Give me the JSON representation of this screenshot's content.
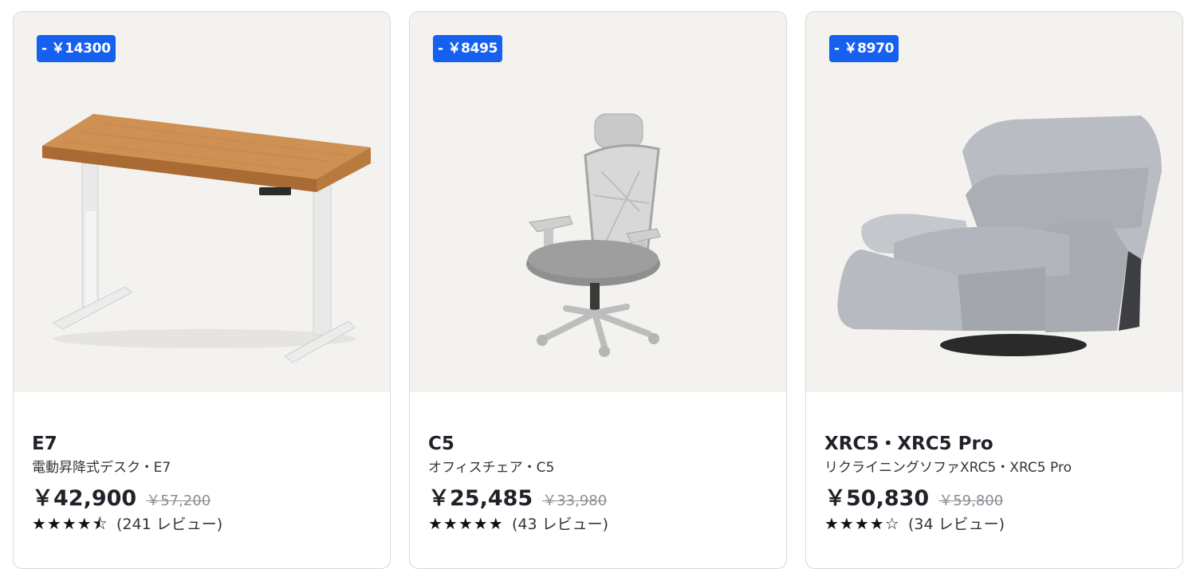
{
  "products": [
    {
      "badge": "- ￥14300",
      "name": "E7",
      "description": "電動昇降式デスク・E7",
      "price": "￥42,900",
      "original_price": "￥57,200",
      "stars": "★★★★⯪",
      "rating": 4.5,
      "reviews": "(241 レビュー)",
      "image_icon": "standing-desk-image"
    },
    {
      "badge": "- ￥8495",
      "name": "C5",
      "description": "オフィスチェア・C5",
      "price": "￥25,485",
      "original_price": "￥33,980",
      "stars": "★★★★★",
      "rating": 5,
      "reviews": "(43 レビュー)",
      "image_icon": "office-chair-image"
    },
    {
      "badge": "- ￥8970",
      "name": "XRC5・XRC5 Pro",
      "description": "リクライニングソファXRC5・XRC5 Pro",
      "price": "￥50,830",
      "original_price": "￥59,800",
      "stars": "★★★★☆",
      "rating": 4,
      "reviews": "(34 レビュー)",
      "image_icon": "recliner-sofa-image"
    }
  ],
  "colors": {
    "badge": "#1660f0",
    "image_bg": "#f3f2ef",
    "border": "#d9d9d9",
    "text": "#1f2329",
    "strike": "#8a8e94"
  }
}
